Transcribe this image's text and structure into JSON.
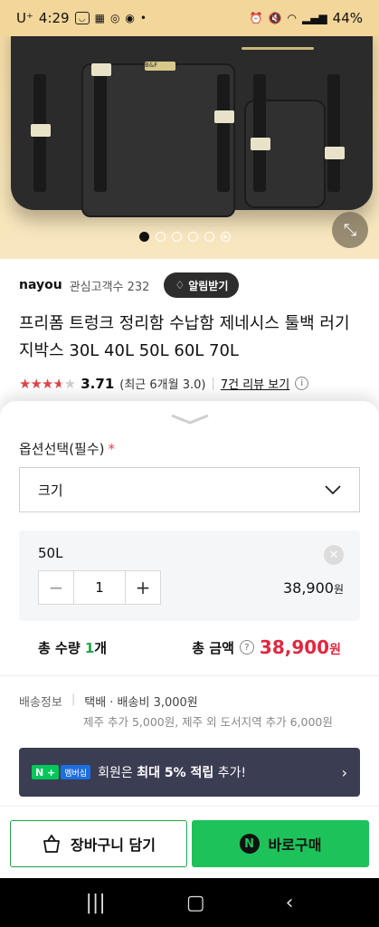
{
  "status_bar": {
    "time": "4:29",
    "carrier": "U⁺",
    "battery": "44%",
    "left_icons": [
      "smiley-app-icon",
      "dudi-loca-icon",
      "shield-app-icon",
      "vpn-icon"
    ],
    "right_icons": [
      "alarm-icon",
      "mute-icon",
      "wifi-icon",
      "signal-icon"
    ]
  },
  "gallery": {
    "dot_count": 6,
    "active_index": 0,
    "bag_logo": "B&F"
  },
  "seller": {
    "name": "nayou",
    "follower_label": "관심고객수 232",
    "alert_label": "알림받기"
  },
  "product": {
    "title": "프리폼 트렁크 정리함 수납함 제네시스 툴백 러기지박스 30L 40L 50L 60L 70L"
  },
  "rating": {
    "score": "3.71",
    "stars_filled": 3.71,
    "recent": "(최근 6개월 3.0)",
    "review_link": "7건 리뷰 보기"
  },
  "options": {
    "label": "옵션선택(필수)",
    "required_mark": "*",
    "select_value": "크기"
  },
  "selected_item": {
    "name": "50L",
    "quantity": "1",
    "price": "38,900",
    "currency": "원"
  },
  "total": {
    "qty_prefix": "총 수량 ",
    "qty_num": "1",
    "qty_suffix": "개",
    "amount_label": "총 금액",
    "price": "38,900",
    "currency": "원"
  },
  "shipping": {
    "label": "배송정보",
    "main": "택배 · 배송비 3,000원",
    "sub": "제주 추가 5,000원, 제주 외 도서지역 추가 6,000원"
  },
  "membership": {
    "badge1": "N +",
    "badge2": "멤버십",
    "text_prefix": " 회원은 ",
    "text_bold": "최대 5% 적립",
    "text_suffix": " 추가!"
  },
  "buttons": {
    "cart": "장바구니 담기",
    "buy": "바로구매"
  },
  "colors": {
    "accent_green": "#1ec25a",
    "price_red": "#e0283e",
    "star_red": "#e0444b",
    "membership_bg": "#3b3d53"
  }
}
